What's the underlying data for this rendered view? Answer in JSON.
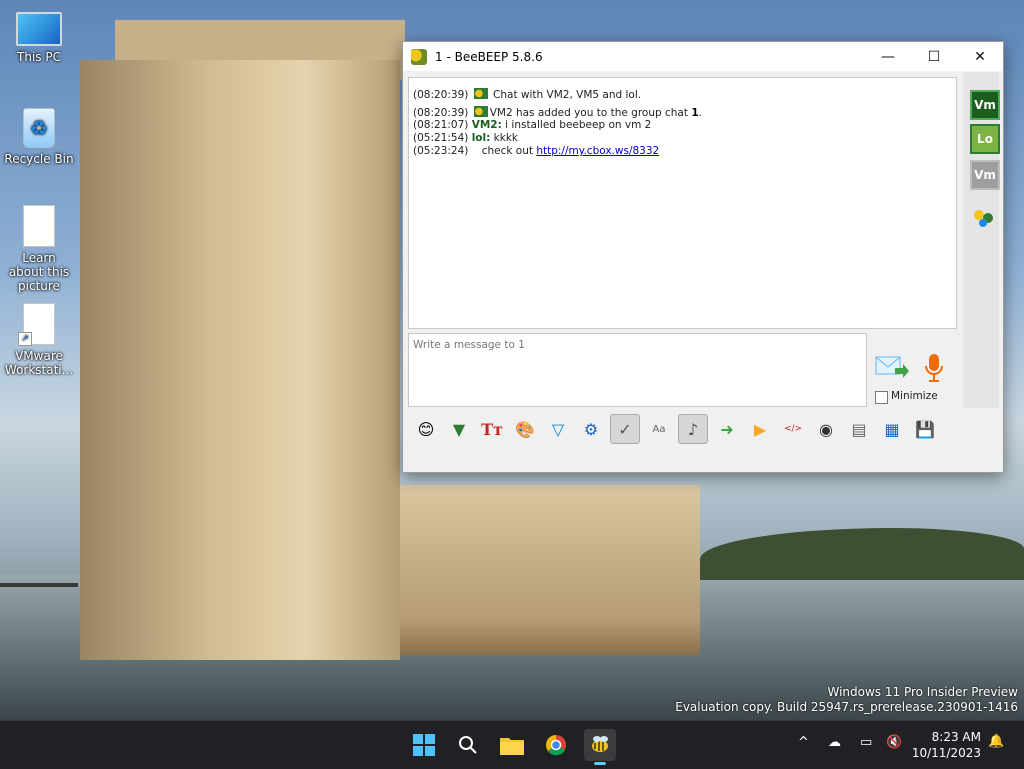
{
  "desktop": {
    "icons": [
      {
        "label": "This PC"
      },
      {
        "label": "Recycle Bin"
      },
      {
        "label": "Learn about this picture"
      },
      {
        "label": "VMware Workstati..."
      }
    ],
    "watermark": {
      "line1": "Windows 11 Pro Insider Preview",
      "line2": "Evaluation copy. Build 25947.rs_prerelease.230901-1416"
    }
  },
  "window": {
    "title": "1 - BeeBEEP 5.8.6",
    "controls": {
      "minimize": "—",
      "maximize": "☐",
      "close": "✕"
    },
    "messages": [
      {
        "time": "(08:20:39)",
        "text": "Chat with VM2, VM5 and lol."
      },
      {
        "time": "(08:20:39)",
        "text_before": "VM2 has added you to the group chat ",
        "bold": "1",
        "text_after": "."
      },
      {
        "time": "(08:21:07)",
        "sender": "VM2:",
        "text": "i installed beebeep on vm 2"
      },
      {
        "time": "(05:21:54)",
        "sender": "lol:",
        "text": "kkkk"
      },
      {
        "time": "(05:23:24)",
        "text": "check out ",
        "link": "http://my.cbox.ws/8332"
      }
    ],
    "input": {
      "placeholder": "Write a message to 1"
    },
    "minimize_label": "Minimize",
    "users": [
      {
        "abbr": "Vm",
        "color": "#1b5e20",
        "border": "#4caf50"
      },
      {
        "abbr": "Lo",
        "color": "#7cb342",
        "border": "#2e7d32"
      },
      {
        "abbr": "Vm",
        "color": "#9e9e9e",
        "border": "#bdbdbd"
      }
    ],
    "toolbar_icons": [
      "emoticon-icon",
      "highlight-icon",
      "font-icon",
      "color-palette-icon",
      "filter-icon",
      "settings-gear-icon",
      "spell-check-icon",
      "text-format-icon",
      "note-icon",
      "send-file-icon",
      "send-folder-icon",
      "html-icon",
      "screenshot-icon",
      "clear-icon",
      "save-icon",
      "export-icon"
    ]
  },
  "taskbar": {
    "apps": [
      "start-icon",
      "search-icon",
      "file-explorer-icon",
      "chrome-icon",
      "beebeep-icon"
    ],
    "clock": {
      "time": "8:23 AM",
      "date": "10/11/2023"
    }
  }
}
